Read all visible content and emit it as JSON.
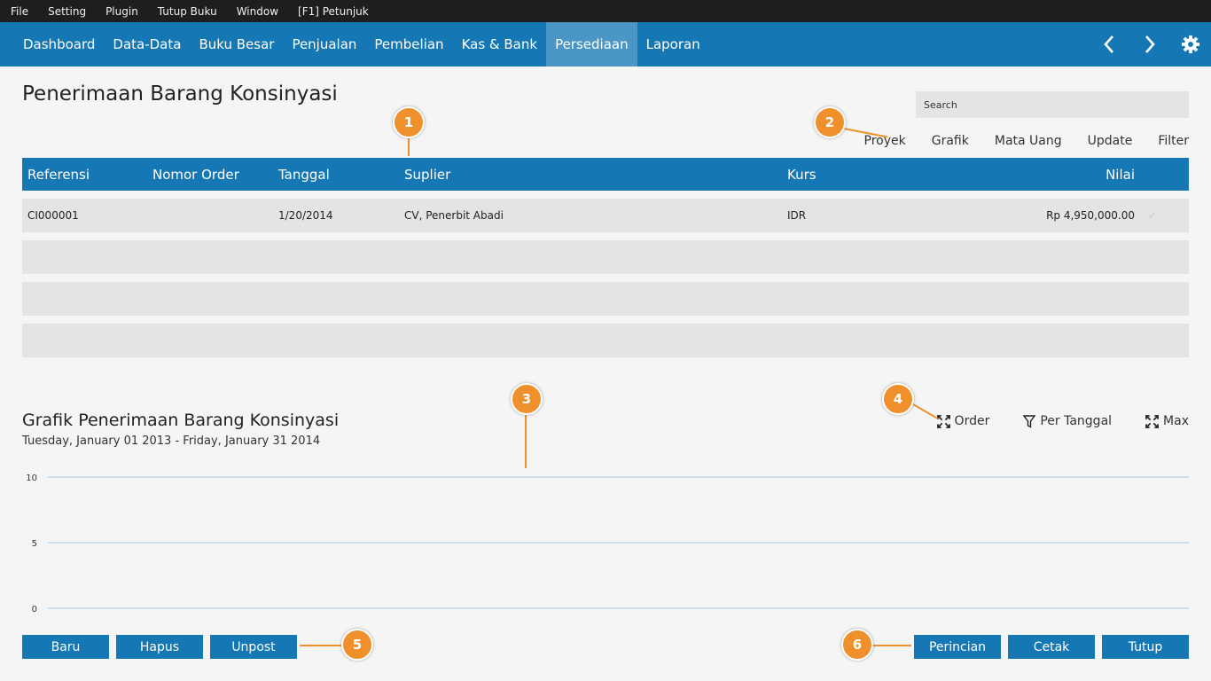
{
  "menubar": {
    "items": [
      "File",
      "Setting",
      "Plugin",
      "Tutup Buku",
      "Window",
      "[F1] Petunjuk"
    ]
  },
  "nav": {
    "items": [
      "Dashboard",
      "Data-Data",
      "Buku Besar",
      "Penjualan",
      "Pembelian",
      "Kas & Bank",
      "Persediaan",
      "Laporan"
    ],
    "active": "Persediaan",
    "icons": [
      "chevron-left-icon",
      "chevron-right-icon",
      "gear-icon"
    ]
  },
  "page": {
    "title": "Penerimaan Barang Konsinyasi"
  },
  "search": {
    "placeholder": "Search"
  },
  "toolbar": {
    "items": [
      "Proyek",
      "Grafik",
      "Mata Uang",
      "Update",
      "Filter"
    ]
  },
  "table": {
    "headers": {
      "referensi": "Referensi",
      "nomor_order": "Nomor Order",
      "tanggal": "Tanggal",
      "suplier": "Suplier",
      "kurs": "Kurs",
      "nilai": "Nilai"
    },
    "rows": [
      {
        "referensi": "CI000001",
        "nomor_order": "",
        "tanggal": "1/20/2014",
        "suplier": "CV, Penerbit Abadi",
        "kurs": "IDR",
        "nilai": "Rp 4,950,000.00",
        "check": "✓"
      }
    ]
  },
  "chart_section": {
    "title": "Grafik Penerimaan Barang Konsinyasi",
    "subtitle": "Tuesday, January 01 2013 - Friday, January 31 2014",
    "tools": {
      "order": "Order",
      "per_tanggal": "Per Tanggal",
      "max": "Max"
    }
  },
  "chart_data": {
    "type": "line",
    "series": [],
    "y_ticks": [
      "10",
      "5",
      "0"
    ],
    "ylim": [
      0,
      10
    ],
    "grid": true
  },
  "buttons": {
    "baru": "Baru",
    "hapus": "Hapus",
    "unpost": "Unpost",
    "perincian": "Perincian",
    "cetak": "Cetak",
    "tutup": "Tutup"
  },
  "callouts": [
    "1",
    "2",
    "3",
    "4",
    "5",
    "6"
  ],
  "colors": {
    "accent": "#1577b4",
    "callout": "#f0902c",
    "grid": "#a9cfe3"
  }
}
